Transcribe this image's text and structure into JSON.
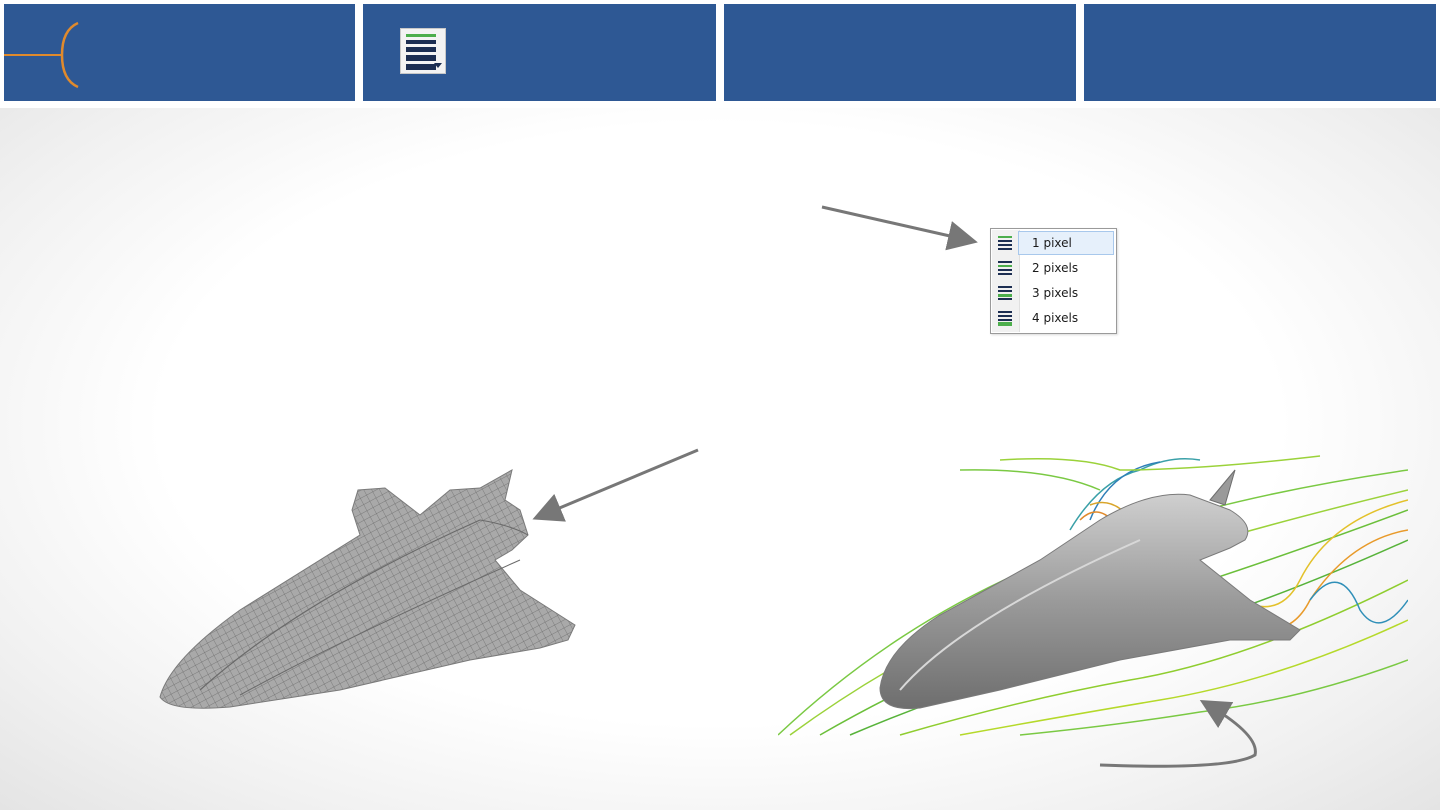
{
  "header": {
    "cells": [
      "title-cell",
      "line-width-cell",
      "empty-cell-3",
      "empty-cell-4"
    ],
    "line_width_button": {
      "icon": "line-width-icon"
    }
  },
  "line_width_menu": {
    "items": [
      {
        "label": "1 pixel",
        "selected": true
      },
      {
        "label": "2 pixels",
        "selected": false
      },
      {
        "label": "3 pixels",
        "selected": false
      },
      {
        "label": "4 pixels",
        "selected": false
      }
    ]
  },
  "colors": {
    "header_blue": "#2e5894",
    "logo_orange": "#e08a2c",
    "icon_green": "#4cae4c",
    "icon_navy": "#1c2e52",
    "arrow_gray": "#777777"
  }
}
